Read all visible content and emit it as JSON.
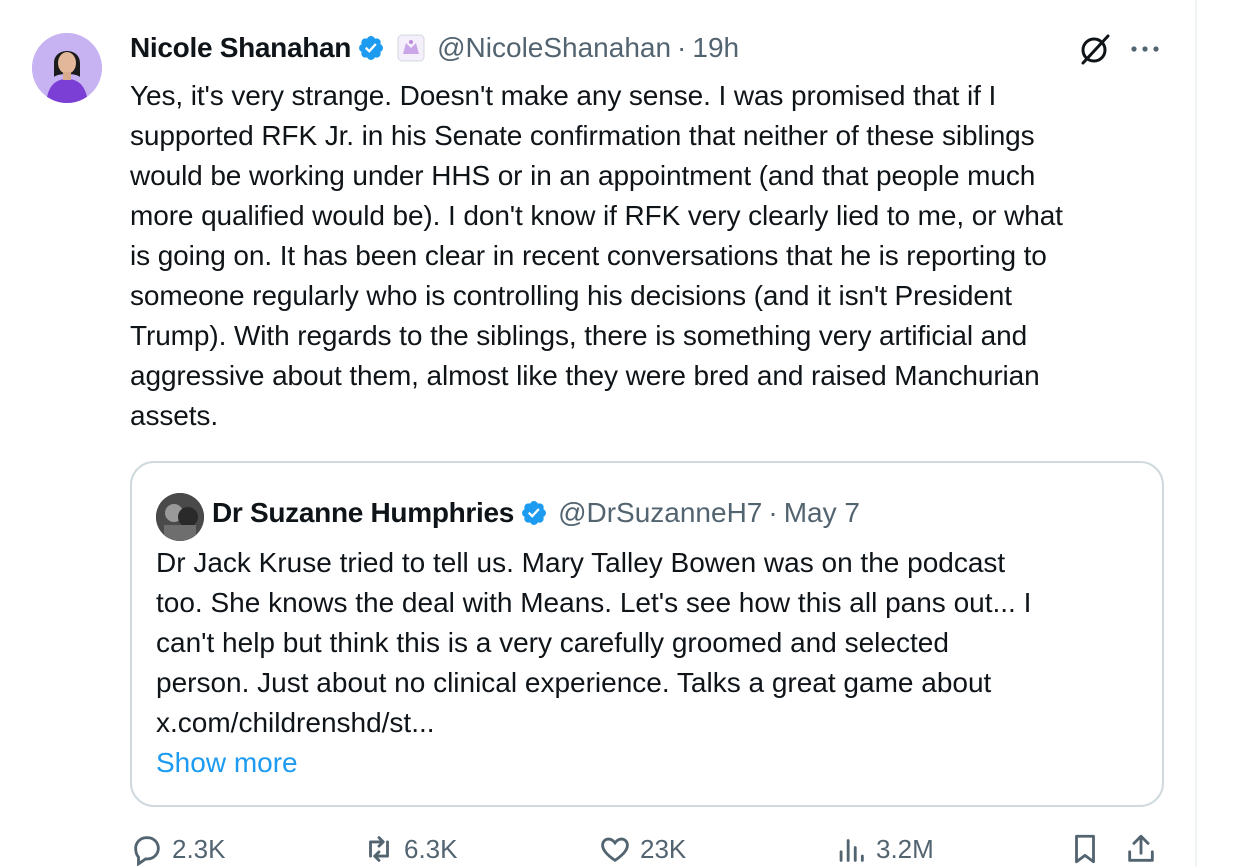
{
  "tweet": {
    "display_name": "Nicole Shanahan",
    "handle": "@NicoleShanahan",
    "separator": "·",
    "time": "19h",
    "text": "Yes, it's very strange. Doesn't make any sense. I was promised that if I\nsupported RFK Jr. in his Senate confirmation that neither of these siblings\nwould be working under HHS or in an appointment (and that people much\nmore qualified would be). I don't know if RFK very clearly lied to me, or what\nis going on. It has been clear in recent conversations that he is reporting to\nsomeone regularly who is controlling his decisions (and it isn't President\nTrump). With regards to the siblings, there is something very artificial and\naggressive about them, almost like they were bred and raised Manchurian\nassets.",
    "avatar_icon": "profile-avatar",
    "verified_icon": "verified-badge-icon",
    "affiliate_icon": "affiliate-badge-icon",
    "grok_icon": "grok-icon",
    "more_icon": "more-icon"
  },
  "quote": {
    "display_name": "Dr Suzanne Humphries",
    "handle": "@DrSuzanneH7",
    "separator": "·",
    "date": "May 7",
    "text": "Dr Jack Kruse tried to tell us. Mary Talley Bowen was on the podcast\ntoo. She knows the deal with Means. Let's see how this all pans out... I\ncan't help but think this is a very carefully groomed and selected\nperson. Just about no clinical experience. Talks a great game about\nx.com/childrenshd/st...",
    "show_more": "Show more"
  },
  "actions": {
    "replies": "2.3K",
    "reposts": "6.3K",
    "likes": "23K",
    "views": "3.2M"
  },
  "colors": {
    "text": "#0f1419",
    "muted": "#536471",
    "link": "#1d9bf0",
    "verified": "#1d9bf0",
    "border": "#cfd9de"
  }
}
